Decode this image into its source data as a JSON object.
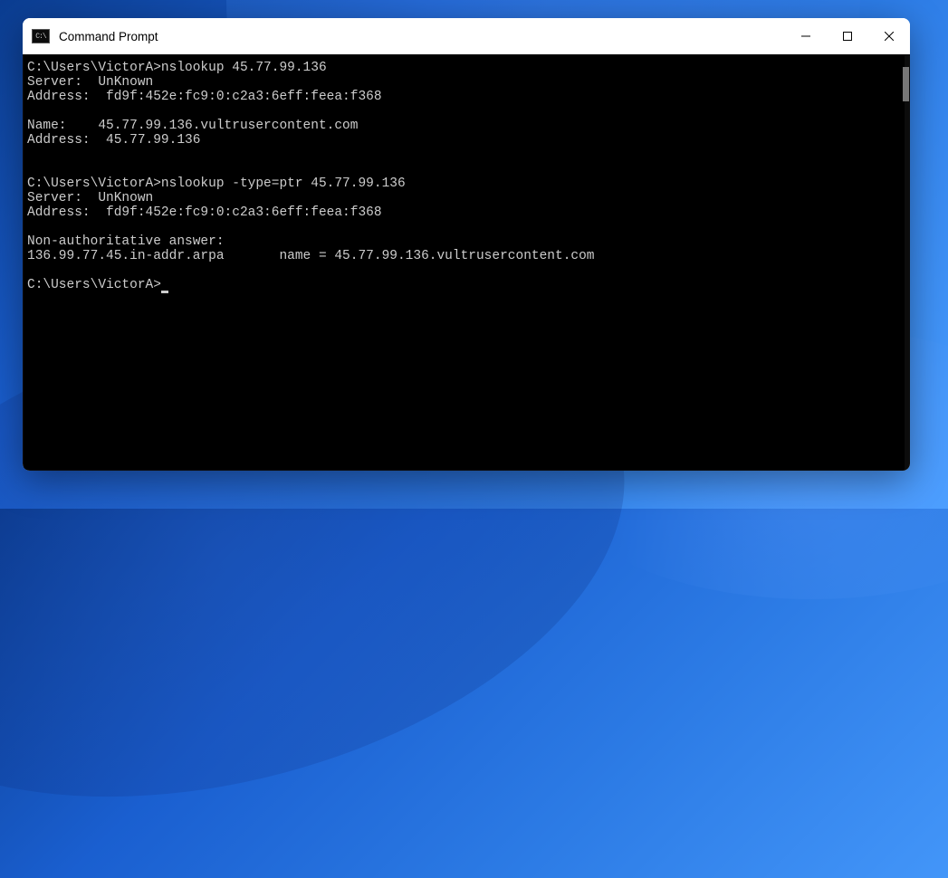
{
  "window": {
    "title": "Command Prompt"
  },
  "terminal": {
    "lines": [
      "C:\\Users\\VictorA>nslookup 45.77.99.136",
      "Server:  UnKnown",
      "Address:  fd9f:452e:fc9:0:c2a3:6eff:feea:f368",
      "",
      "Name:    45.77.99.136.vultrusercontent.com",
      "Address:  45.77.99.136",
      "",
      "",
      "C:\\Users\\VictorA>nslookup -type=ptr 45.77.99.136",
      "Server:  UnKnown",
      "Address:  fd9f:452e:fc9:0:c2a3:6eff:feea:f368",
      "",
      "Non-authoritative answer:",
      "136.99.77.45.in-addr.arpa       name = 45.77.99.136.vultrusercontent.com",
      ""
    ],
    "prompt": "C:\\Users\\VictorA>"
  }
}
